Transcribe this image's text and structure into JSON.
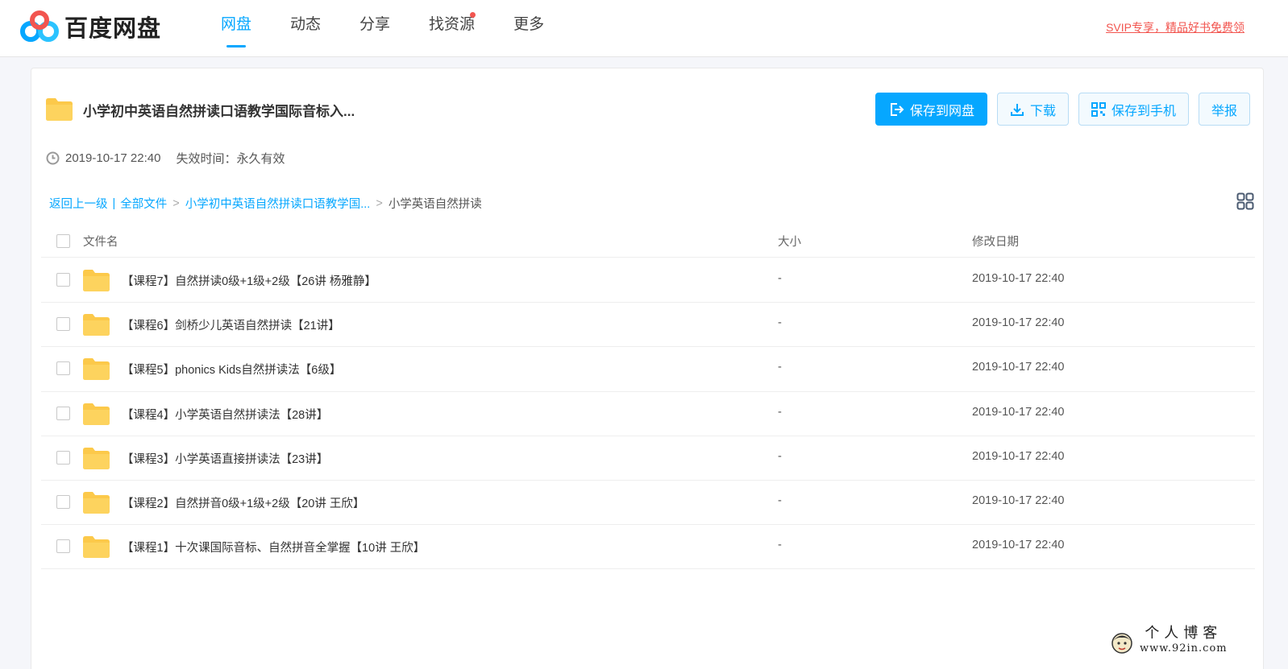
{
  "app": {
    "logo_text": "百度网盘",
    "brand_color": "#06a7ff",
    "accent_red": "#f2554f"
  },
  "nav": {
    "items": [
      {
        "label": "网盘",
        "active": true
      },
      {
        "label": "动态"
      },
      {
        "label": "分享"
      },
      {
        "label": "找资源",
        "badge_dot": true
      },
      {
        "label": "更多"
      }
    ],
    "promo": "SVIP专享，精品好书免费领"
  },
  "share": {
    "title": "小学初中英语自然拼读口语教学国际音标入...",
    "created": "2019-10-17 22:40",
    "expire_label": "失效时间：",
    "expire_value": "永久有效"
  },
  "actions": {
    "save_to_disk": "保存到网盘",
    "download": "下载",
    "save_to_phone": "保存到手机",
    "report": "举报"
  },
  "breadcrumb": {
    "back": "返回上一级",
    "all_files": "全部文件",
    "parent": "小学初中英语自然拼读口语教学国...",
    "current": "小学英语自然拼读"
  },
  "table": {
    "headers": {
      "name": "文件名",
      "size": "大小",
      "date": "修改日期"
    },
    "rows": [
      {
        "name": "【课程7】自然拼读0级+1级+2级【26讲 杨雅静】",
        "size": "-",
        "date": "2019-10-17 22:40"
      },
      {
        "name": "【课程6】剑桥少儿英语自然拼读【21讲】",
        "size": "-",
        "date": "2019-10-17 22:40"
      },
      {
        "name": "【课程5】phonics Kids自然拼读法【6级】",
        "size": "-",
        "date": "2019-10-17 22:40"
      },
      {
        "name": "【课程4】小学英语自然拼读法【28讲】",
        "size": "-",
        "date": "2019-10-17 22:40"
      },
      {
        "name": "【课程3】小学英语直接拼读法【23讲】",
        "size": "-",
        "date": "2019-10-17 22:40"
      },
      {
        "name": "【课程2】自然拼音0级+1级+2级【20讲 王欣】",
        "size": "-",
        "date": "2019-10-17 22:40"
      },
      {
        "name": "【课程1】十次课国际音标、自然拼音全掌握【10讲 王欣】",
        "size": "-",
        "date": "2019-10-17 22:40"
      }
    ]
  },
  "watermark": {
    "top": "个人博客",
    "url": "www.92in.com"
  }
}
